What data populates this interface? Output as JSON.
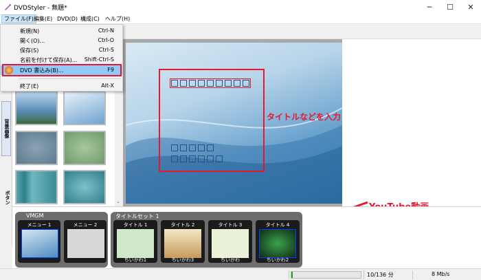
{
  "window": {
    "title": "DVDStyler - 無題*",
    "minimize": "─",
    "maximize": "☐",
    "close": "✕"
  },
  "menubar": [
    "ファイル(F)",
    "編集(E)",
    "DVD(D)",
    "構成(C)",
    "ヘルプ(H)"
  ],
  "file_menu": [
    {
      "label": "新規(N)",
      "shortcut": "Ctrl-N"
    },
    {
      "label": "開く(O)...",
      "shortcut": "Ctrl-O"
    },
    {
      "label": "保存(S)",
      "shortcut": "Ctrl-S"
    },
    {
      "label": "名前を付けて保存(A)...",
      "shortcut": "Shift-Ctrl-S"
    },
    {
      "label": "DVD 書込み(B)...",
      "shortcut": "F9"
    },
    {
      "label": "終了(E)",
      "shortcut": "Alt-X"
    }
  ],
  "sidebar_tabs": {
    "background": "背景画像",
    "buttons": "ボタン"
  },
  "annotations": {
    "title_hint": "タイトルなどを入力",
    "youtube_hint": "YouTube動画"
  },
  "titleset": {
    "vmgm_label": "VMGM",
    "titleset_label": "タイトルセット 1",
    "menus": [
      "メニュー 1",
      "メニュー 2"
    ],
    "titles": [
      {
        "label": "タイトル 1",
        "caption": "ちいかわ1"
      },
      {
        "label": "タイトル 2",
        "caption": "ちいかわ3"
      },
      {
        "label": "タイトル 3",
        "caption": "ちいかわ"
      },
      {
        "label": "タイトル 4",
        "caption": "ちいかわ2"
      }
    ]
  },
  "status": {
    "progress": 0.02,
    "duration": "10/136 分",
    "bitrate": "8 Mb/s"
  },
  "colors": {
    "accent_red": "#e8172f",
    "menu_highlight": "#cce4f7",
    "progress_green": "#06b025"
  }
}
